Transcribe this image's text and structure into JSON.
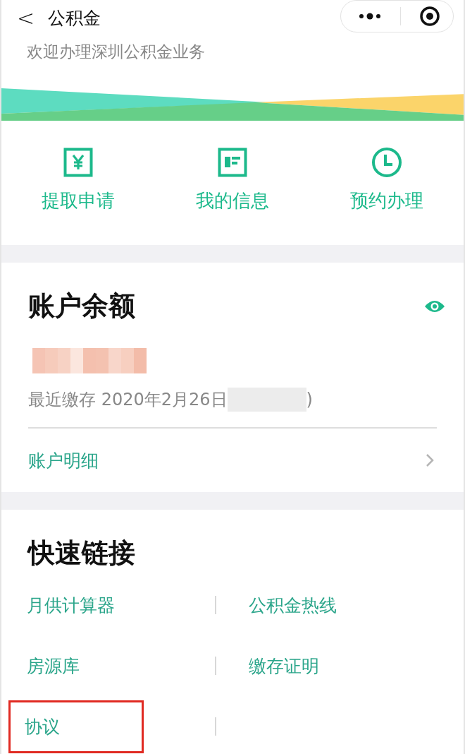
{
  "nav": {
    "back": "<",
    "title": "公积金"
  },
  "subtitle": "欢迎办理深圳公积金业务",
  "shortcuts": [
    {
      "kind": "withdraw",
      "label": "提取申请"
    },
    {
      "kind": "info",
      "label": "我的信息"
    },
    {
      "kind": "appointment",
      "label": "预约办理"
    }
  ],
  "balance": {
    "title": "账户余额",
    "last_deposit": "最近缴存 2020年2月26日",
    "last_deposit_tail": ")",
    "detail_link": "账户明细"
  },
  "quick_links": {
    "title": "快速链接",
    "items": [
      {
        "label": "月供计算器",
        "highlighted": false
      },
      {
        "label": "公积金热线",
        "highlighted": false
      },
      {
        "label": "房源库",
        "highlighted": false
      },
      {
        "label": "缴存证明",
        "highlighted": false
      },
      {
        "label": "协议",
        "highlighted": true
      }
    ]
  }
}
